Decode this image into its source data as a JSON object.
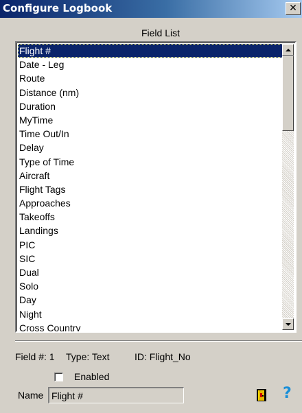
{
  "window": {
    "title": "Configure Logbook",
    "close_glyph": "✕"
  },
  "field_list": {
    "label": "Field List",
    "selected_index": 0,
    "items": [
      "Flight #",
      "Date - Leg",
      "Route",
      "Distance (nm)",
      "Duration",
      "MyTime",
      "Time Out/In",
      "Delay",
      "Type of Time",
      "Aircraft",
      "Flight Tags",
      "Approaches",
      "Takeoffs",
      "Landings",
      "PIC",
      "SIC",
      "Dual",
      "Solo",
      "Day",
      "Night",
      "Cross Country"
    ]
  },
  "details": {
    "field_number": "Field #: 1",
    "type": "Type: Text",
    "id": "ID: Flight_No",
    "enabled_label": "Enabled",
    "enabled": false,
    "name_label": "Name",
    "name_value": "Flight #"
  },
  "icons": {
    "exit": "exit-door-icon",
    "help": "help-icon",
    "help_glyph": "?"
  },
  "colors": {
    "selection": "#0a246a",
    "title_bar_start": "#0a246a",
    "title_bar_end": "#a6caf0",
    "help_icon": "#1a8fd8",
    "exit_icon_door": "#ffd700"
  }
}
